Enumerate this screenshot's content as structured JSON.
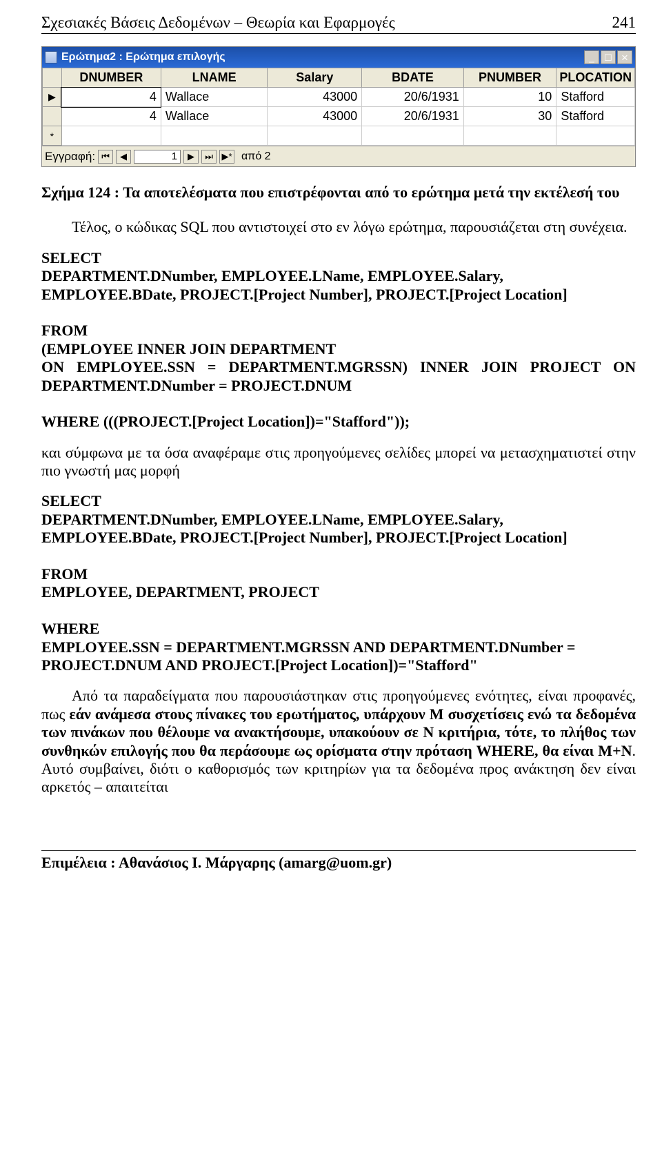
{
  "head": {
    "title": "Σχεσιακές Βάσεις Δεδομένων – Θεωρία και Εφαρμογές",
    "page": "241"
  },
  "shot": {
    "title": "Ερώτημα2 : Ερώτημα επιλογής",
    "cols": [
      "DNUMBER",
      "LNAME",
      "Salary",
      "BDATE",
      "PNUMBER",
      "PLOCATION"
    ],
    "rows": [
      {
        "sel": "▶",
        "dnum": "4",
        "lname": "Wallace",
        "salary": "43000",
        "bdate": "20/6/1931",
        "pnum": "10",
        "ploc": "Stafford"
      },
      {
        "sel": "",
        "dnum": "4",
        "lname": "Wallace",
        "salary": "43000",
        "bdate": "20/6/1931",
        "pnum": "30",
        "ploc": "Stafford"
      }
    ],
    "nav": {
      "label": "Εγγραφή:",
      "value": "1",
      "of": "από 2"
    }
  },
  "caption": "Σχήμα 124 : Τα αποτελέσματα που επιστρέφονται από το ερώτημα μετά την εκτέλεσή του",
  "p1": "Τέλος, ο κώδικας SQL που αντιστοιχεί στο εν λόγω ερώτημα, παρουσιάζεται στη συνέχεια.",
  "sql1": {
    "l1": "SELECT",
    "l2": "DEPARTMENT.DNumber, EMPLOYEE.LName, EMPLOYEE.Salary, EMPLOYEE.BDate, PROJECT.[Project Number], PROJECT.[Project Location]",
    "l3": "FROM",
    "l4": "(EMPLOYEE INNER JOIN DEPARTMENT",
    "l5": "ON EMPLOYEE.SSN = DEPARTMENT.MGRSSN) INNER JOIN PROJECT ON DEPARTMENT.DNumber = PROJECT.DNUM",
    "l6": "WHERE (((PROJECT.[Project Location])=\"Stafford\"));"
  },
  "p2": "και σύμφωνα με τα όσα αναφέραμε στις προηγούμενες σελίδες μπορεί να μετασχηματιστεί στην πιο γνωστή μας μορφή",
  "sql2": {
    "l1": "SELECT",
    "l2": "DEPARTMENT.DNumber, EMPLOYEE.LName, EMPLOYEE.Salary, EMPLOYEE.BDate, PROJECT.[Project Number], PROJECT.[Project Location]",
    "l3": "FROM",
    "l4": "EMPLOYEE, DEPARTMENT, PROJECT",
    "l5": "WHERE",
    "l6": "EMPLOYEE.SSN = DEPARTMENT.MGRSSN  AND DEPARTMENT.DNumber = PROJECT.DNUM AND PROJECT.[Project Location])=\"Stafford\""
  },
  "p3": {
    "a": "Από τα παραδείγματα που παρουσιάστηκαν στις προηγούμενες ενότητες, είναι προφανές, πως ",
    "b": "εάν ανάμεσα στους πίνακες του ερωτήματος, υπάρχουν M συσχετίσεις ενώ τα δεδομένα των πινάκων που θέλουμε να ανακτήσουμε, υπακούουν σε N κριτήρια, τότε, το πλήθος των συνθηκών επιλογής που θα περάσουμε ως ορίσματα στην πρόταση WHERE, θα είναι M+N",
    "c": ". Αυτό συμβαίνει, διότι ο καθορισμός των κριτηρίων για τα δεδομένα προς ανάκτηση δεν είναι αρκετός – απαιτείται"
  },
  "footer": "Επιμέλεια : Αθανάσιος Ι. Μάργαρης (amarg@uom.gr)"
}
